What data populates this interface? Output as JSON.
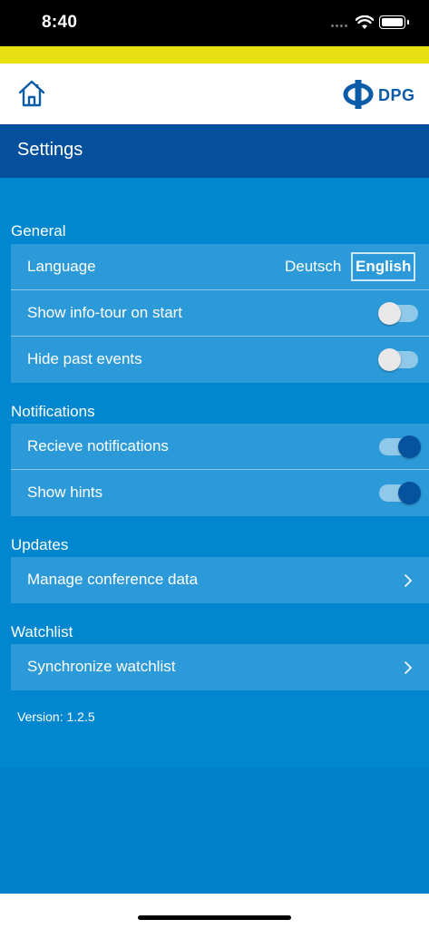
{
  "status_bar": {
    "time": "8:40"
  },
  "header": {
    "logo_text": "DPG"
  },
  "title_bar": {
    "title": "Settings"
  },
  "sections": {
    "general": {
      "header": "General",
      "language_label": "Language",
      "language_options": [
        "Deutsch",
        "English"
      ],
      "language_selected": "English",
      "info_tour_label": "Show info-tour on start",
      "info_tour_enabled": false,
      "hide_past_label": "Hide past events",
      "hide_past_enabled": false
    },
    "notifications": {
      "header": "Notifications",
      "receive_label": "Recieve notifications",
      "receive_enabled": true,
      "hints_label": "Show hints",
      "hints_enabled": true
    },
    "updates": {
      "header": "Updates",
      "manage_label": "Manage conference data"
    },
    "watchlist": {
      "header": "Watchlist",
      "sync_label": "Synchronize watchlist"
    }
  },
  "version": "Version: 1.2.5",
  "colors": {
    "yellow_bar": "#e8e012",
    "title_bar": "#04509d",
    "content_bg": "#0187d0",
    "row_bg": "#2c9ad8",
    "toggle_on_knob": "#05529f"
  }
}
